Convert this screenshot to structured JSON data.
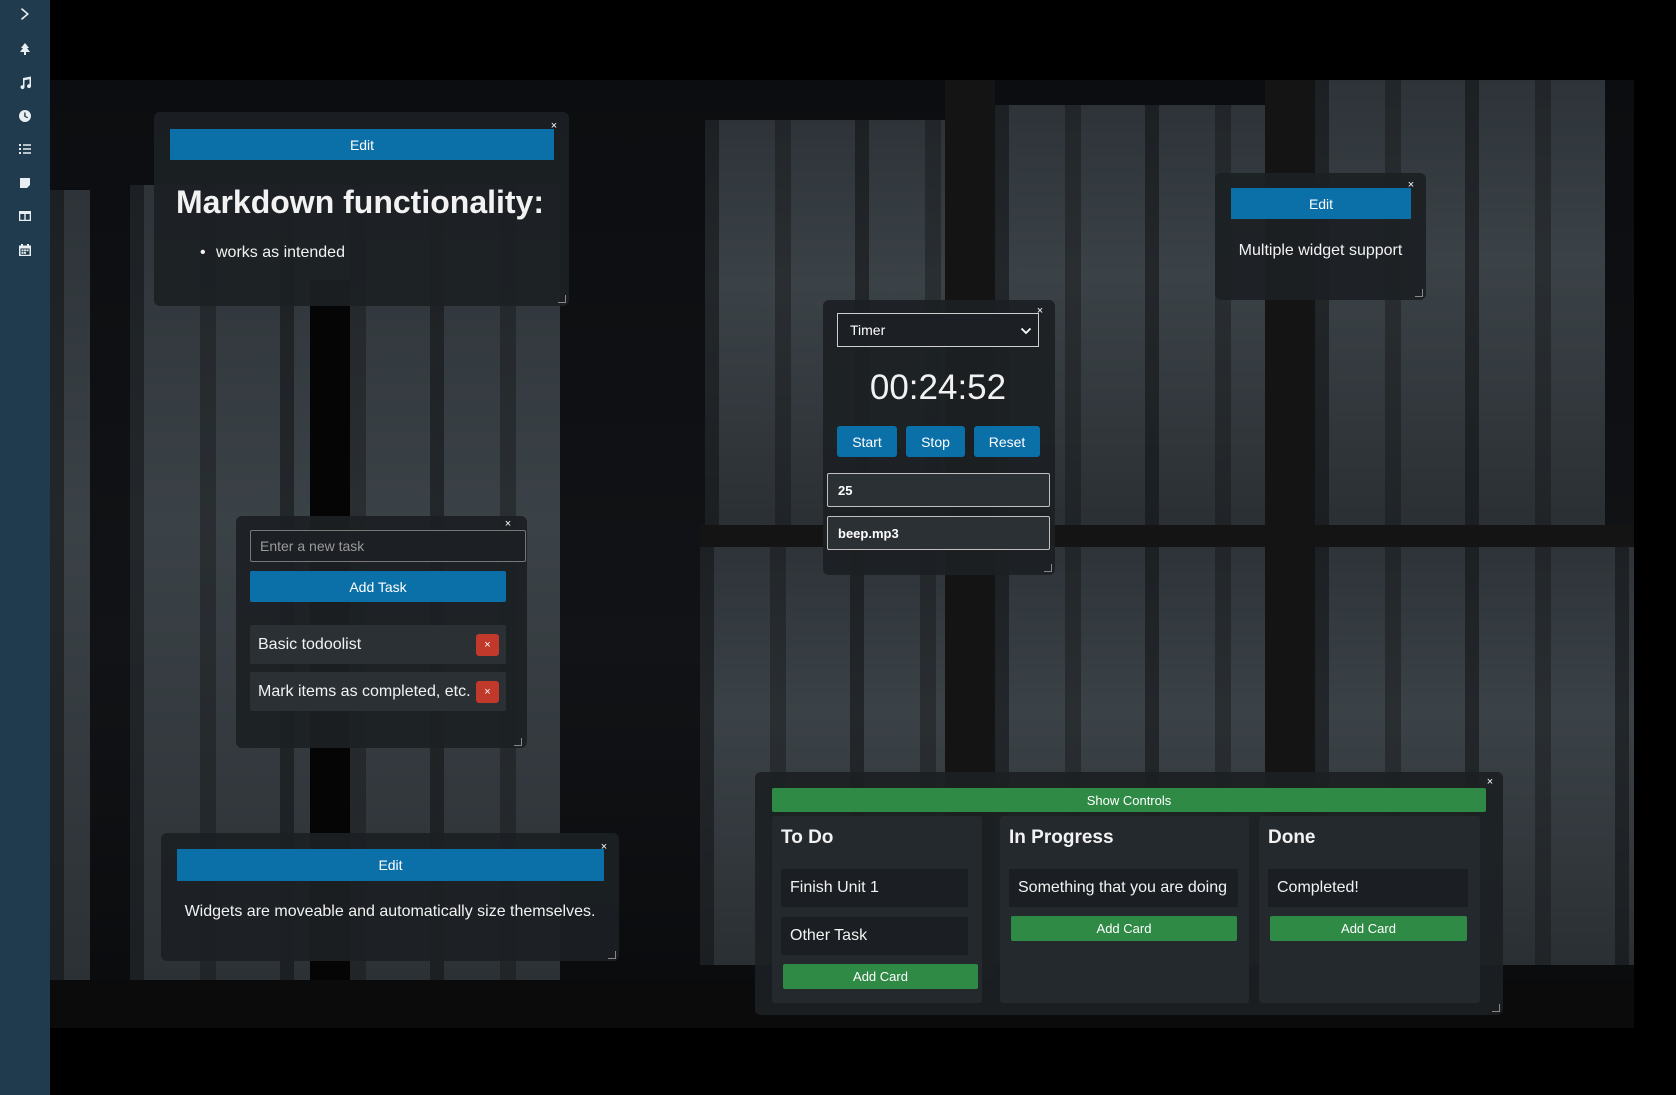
{
  "sidebar": {
    "items": [
      {
        "icon": "chevron-right-icon"
      },
      {
        "icon": "tree-icon"
      },
      {
        "icon": "music-icon"
      },
      {
        "icon": "clock-icon"
      },
      {
        "icon": "checklist-icon"
      },
      {
        "icon": "note-icon"
      },
      {
        "icon": "kanban-icon"
      },
      {
        "icon": "calendar-icon"
      }
    ]
  },
  "markdown_widget": {
    "edit_label": "Edit",
    "heading": "Markdown functionality:",
    "list_items": [
      "works as intended"
    ]
  },
  "note_widget_right": {
    "edit_label": "Edit",
    "text": "Multiple widget support"
  },
  "note_widget_bottom": {
    "edit_label": "Edit",
    "text": "Widgets are moveable and automatically size themselves."
  },
  "timer_widget": {
    "mode": "Timer",
    "display": "00:24:52",
    "start_label": "Start",
    "stop_label": "Stop",
    "reset_label": "Reset",
    "minutes_value": "25",
    "sound_value": "beep.mp3"
  },
  "todo_widget": {
    "input_placeholder": "Enter a new task",
    "add_label": "Add Task",
    "tasks": [
      "Basic todoolist",
      "Mark items as completed, etc."
    ],
    "delete_label": "×"
  },
  "kanban_widget": {
    "show_controls_label": "Show Controls",
    "columns": [
      {
        "title": "To Do",
        "cards": [
          "Finish Unit 1",
          "Other Task"
        ],
        "add_label": "Add Card"
      },
      {
        "title": "In Progress",
        "cards": [
          "Something that you are doing"
        ],
        "add_label": "Add Card"
      },
      {
        "title": "Done",
        "cards": [
          "Completed!"
        ],
        "add_label": "Add Card"
      }
    ]
  },
  "close_glyph": "×",
  "colors": {
    "sidebar": "#1f3b4d",
    "primary_button": "#0b6fa8",
    "success_button": "#2e8a45",
    "danger_button": "#c0392b",
    "widget_bg": "#1c2024"
  }
}
